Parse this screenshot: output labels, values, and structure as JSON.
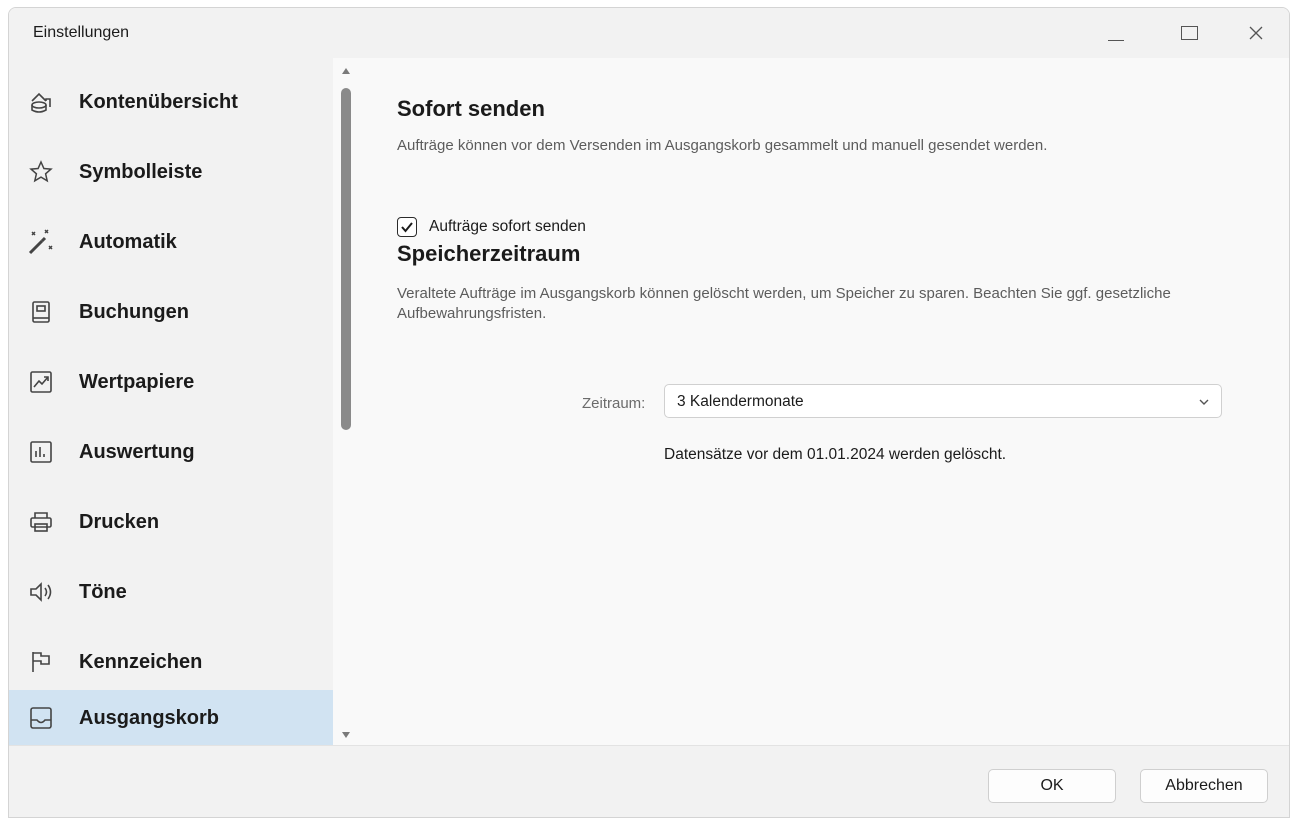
{
  "window": {
    "title": "Einstellungen"
  },
  "window_controls": {
    "minimize_icon": "minimize-icon",
    "maximize_icon": "maximize-icon",
    "close_icon": "close-icon",
    "close_glyph": "✕"
  },
  "sidebar": {
    "items": [
      {
        "label": "Kontenübersicht",
        "icon": "account-overview-icon"
      },
      {
        "label": "Symbolleiste",
        "icon": "star-icon"
      },
      {
        "label": "Automatik",
        "icon": "magic-wand-icon"
      },
      {
        "label": "Buchungen",
        "icon": "book-icon"
      },
      {
        "label": "Wertpapiere",
        "icon": "chart-trend-icon"
      },
      {
        "label": "Auswertung",
        "icon": "bar-chart-icon"
      },
      {
        "label": "Drucken",
        "icon": "printer-icon"
      },
      {
        "label": "Töne",
        "icon": "speaker-icon"
      },
      {
        "label": "Kennzeichen",
        "icon": "flag-icon"
      },
      {
        "label": "Ausgangskorb",
        "icon": "outbox-tray-icon",
        "selected": true
      }
    ]
  },
  "sections": {
    "send_now": {
      "title": "Sofort senden",
      "description": "Aufträge können vor dem Versenden im Ausgangskorb gesammelt und manuell gesendet werden.",
      "checkbox_label": "Aufträge sofort senden",
      "checked": true
    },
    "retention": {
      "title": "Speicherzeitraum",
      "description": "Veraltete Aufträge im Ausgangskorb können gelöscht werden, um Speicher zu sparen. Beachten Sie ggf. gesetzliche Aufbewahrungsfristen.",
      "field_label": "Zeitraum:",
      "selected_value": "3 Kalendermonate",
      "hint": "Datensätze vor dem 01.01.2024 werden gelöscht."
    }
  },
  "footer": {
    "ok_label": "OK",
    "cancel_label": "Abbrechen"
  },
  "colors": {
    "selected_item_bg": "#d1e3f2",
    "sidebar_bg": "#f2f2f2",
    "content_bg": "#f9f9f9"
  }
}
